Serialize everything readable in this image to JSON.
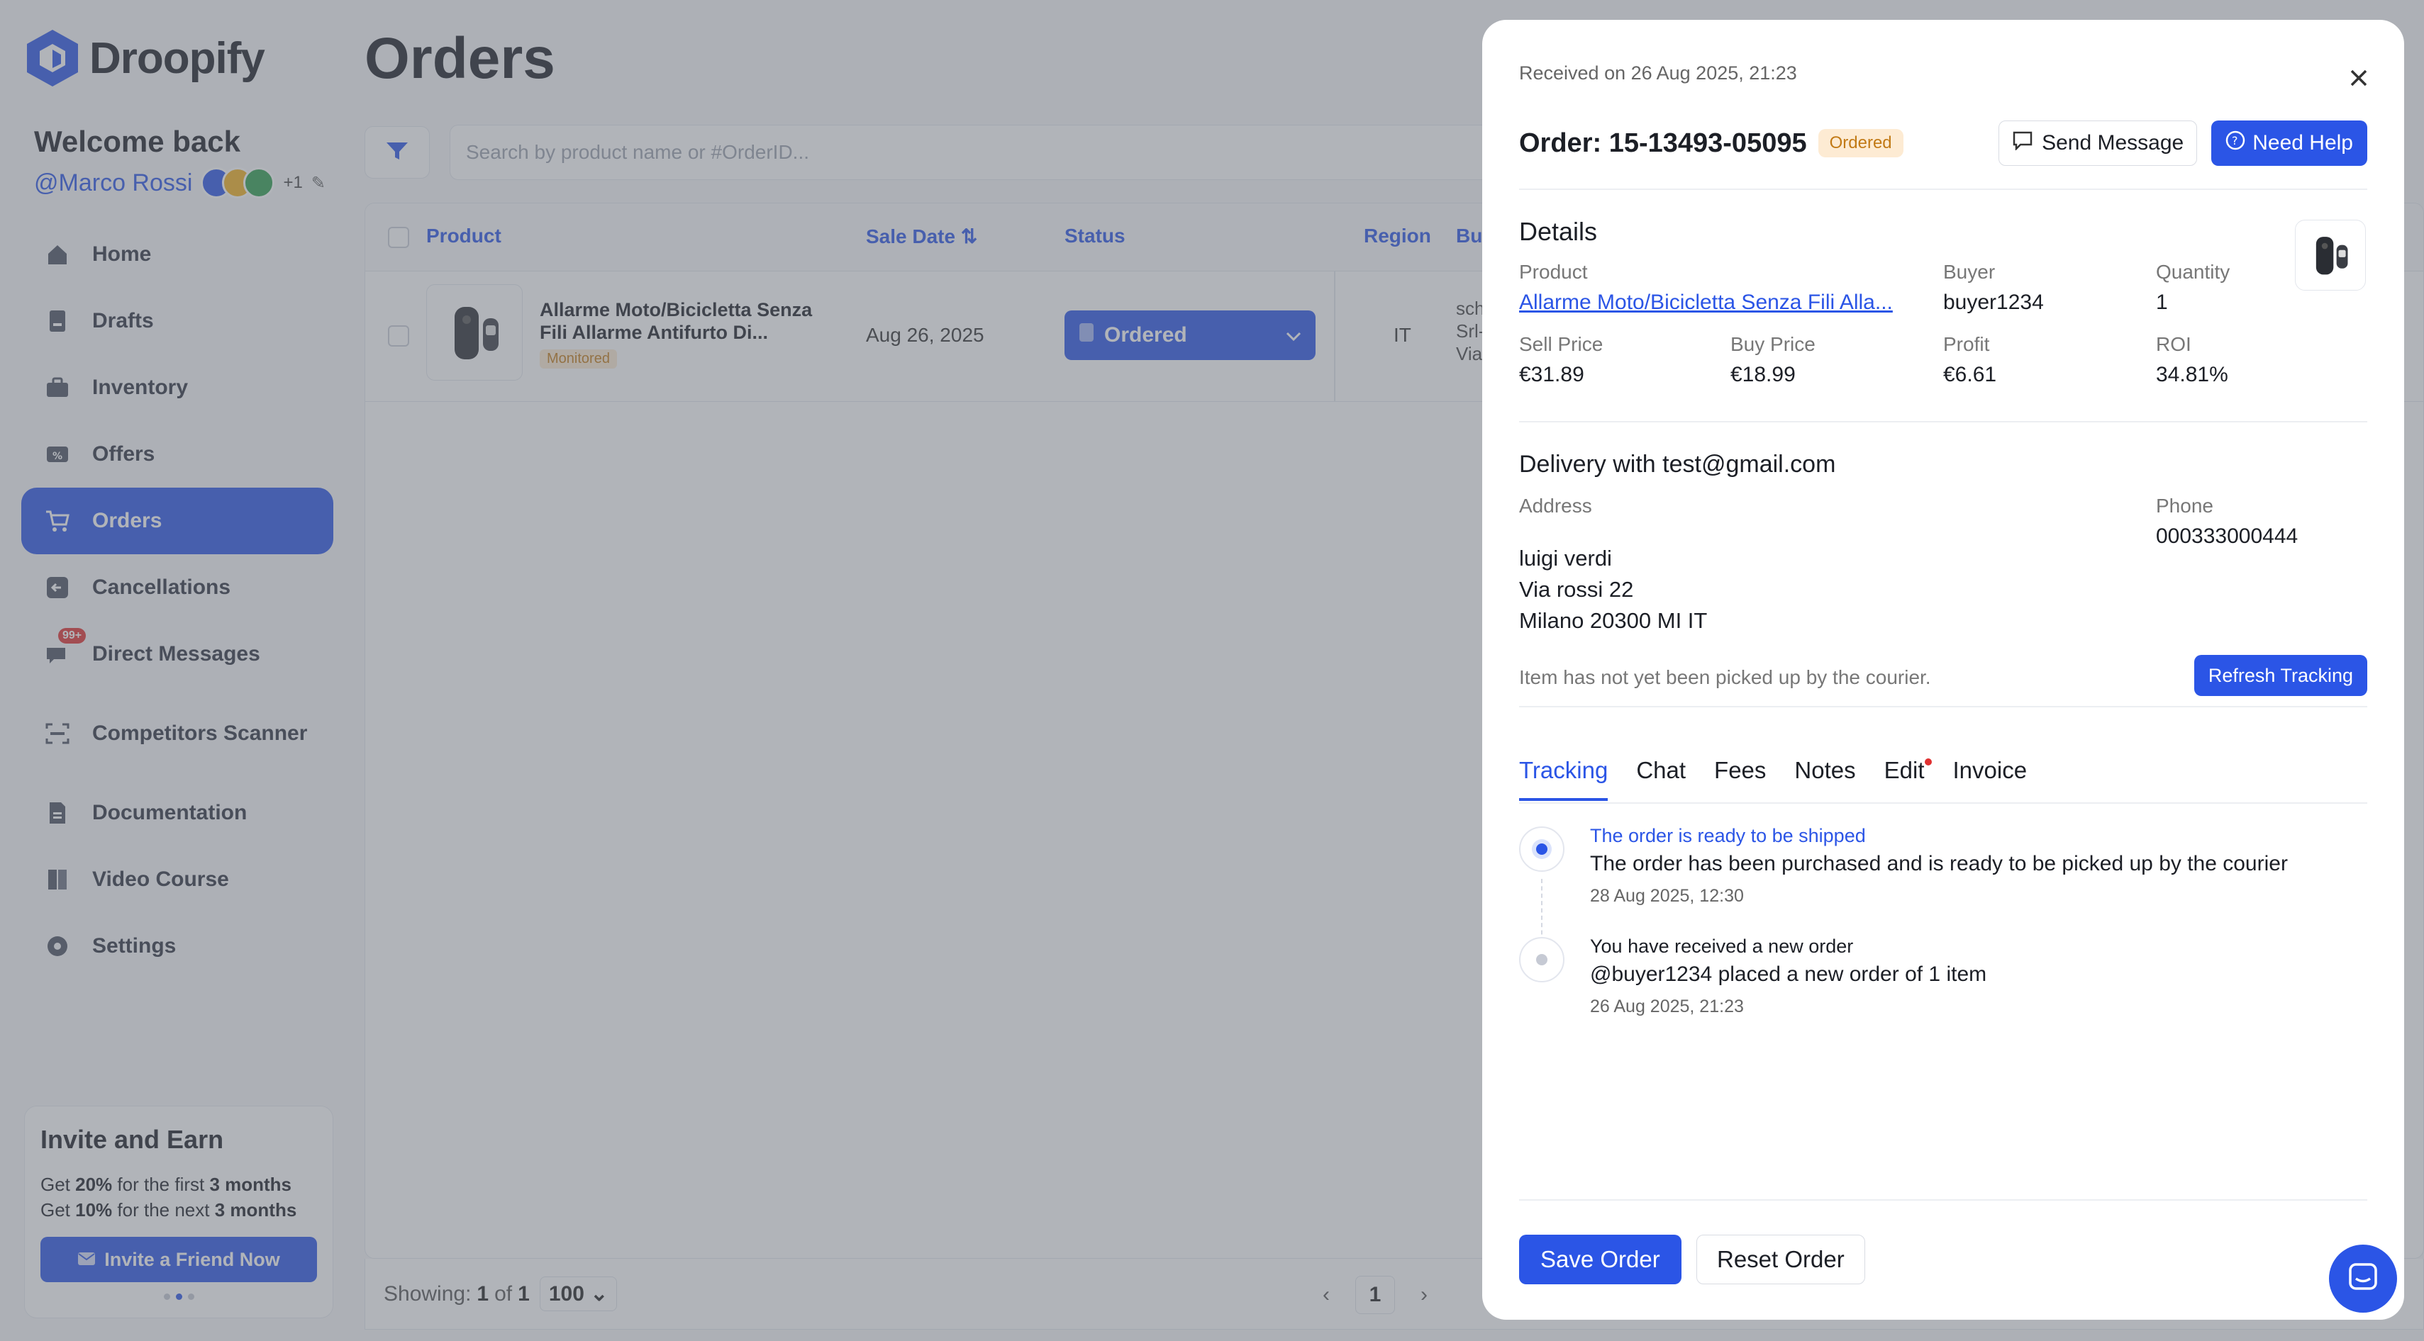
{
  "app": {
    "name": "Droopify"
  },
  "sidebar": {
    "welcome": "Welcome back",
    "user": "@Marco Rossi",
    "extra_count": "+1",
    "items": [
      {
        "label": "Home",
        "icon": "home-icon"
      },
      {
        "label": "Drafts",
        "icon": "drafts-icon"
      },
      {
        "label": "Inventory",
        "icon": "inventory-icon"
      },
      {
        "label": "Offers",
        "icon": "offers-icon"
      },
      {
        "label": "Orders",
        "icon": "cart-icon",
        "active": true
      },
      {
        "label": "Cancellations",
        "icon": "cancel-icon"
      },
      {
        "label": "Direct Messages",
        "icon": "message-icon",
        "badge": "99+"
      },
      {
        "label": "Competitors Scanner",
        "icon": "scanner-icon"
      },
      {
        "label": "Documentation",
        "icon": "document-icon"
      },
      {
        "label": "Video Course",
        "icon": "book-icon"
      },
      {
        "label": "Settings",
        "icon": "gear-icon"
      }
    ],
    "invite": {
      "title": "Invite and Earn",
      "line1_a": "Get ",
      "line1_pct": "20%",
      "line1_b": " for the first ",
      "line1_period": "3 months",
      "line2_a": "Get ",
      "line2_pct": "10%",
      "line2_b": " for the next ",
      "line2_period": "3 months",
      "button": "Invite a Friend Now"
    }
  },
  "main": {
    "title": "Orders",
    "search_placeholder": "Search by product name or #OrderID...",
    "columns": {
      "product": "Product",
      "sale_date": "Sale Date",
      "status": "Status",
      "region": "Region",
      "buyer": "Bu"
    },
    "row": {
      "product": "Allarme Moto/Bicicletta Senza Fili Allarme Antifurto Di...",
      "tag": "Monitored",
      "sale_date": "Aug 26, 2025",
      "status": "Ordered",
      "region": "IT",
      "buyer_l1": "sch",
      "buyer_l2": "Srl-",
      "buyer_l3": "Via"
    },
    "footer": {
      "showing_label": "Showing:",
      "showing_cur": "1",
      "of_label": "of",
      "showing_total": "1",
      "per_page": "100",
      "page": "1"
    }
  },
  "panel": {
    "received": "Received on 26 Aug 2025, 21:23",
    "order_title": "Order: 15-13493-05095",
    "status_badge": "Ordered",
    "send_message": "Send Message",
    "need_help": "Need Help",
    "details_title": "Details",
    "product_label": "Product",
    "product_value": "Allarme Moto/Bicicletta Senza Fili Alla...",
    "buyer_label": "Buyer",
    "buyer_value": "buyer1234",
    "quantity_label": "Quantity",
    "quantity_value": "1",
    "sell_label": "Sell Price",
    "sell_value": "€31.89",
    "buy_label": "Buy Price",
    "buy_value": "€18.99",
    "profit_label": "Profit",
    "profit_value": "€6.61",
    "roi_label": "ROI",
    "roi_value": "34.81%",
    "delivery_title": "Delivery with test@gmail.com",
    "address_label": "Address",
    "address_line1": "luigi verdi",
    "address_line2": "Via rossi 22",
    "address_line3": "Milano 20300 MI IT",
    "phone_label": "Phone",
    "phone_value": "000333000444",
    "tracking_status": "Item has not yet been picked up by the courier.",
    "refresh_tracking": "Refresh Tracking",
    "tabs": [
      "Tracking",
      "Chat",
      "Fees",
      "Notes",
      "Edit",
      "Invoice"
    ],
    "timeline": [
      {
        "title": "The order is ready to be shipped",
        "desc": "The order has been purchased and is ready to be picked up by the courier",
        "time": "28 Aug 2025, 12:30"
      },
      {
        "title": "You have received a new order",
        "desc": "@buyer1234 placed a new order of 1 item",
        "time": "26 Aug 2025, 21:23"
      }
    ],
    "save_order": "Save Order",
    "reset_order": "Reset Order"
  },
  "colors": {
    "accent": "#2b55e6",
    "badge_bg": "#fdebd3",
    "badge_text": "#c27a16",
    "alert": "#e03131"
  }
}
